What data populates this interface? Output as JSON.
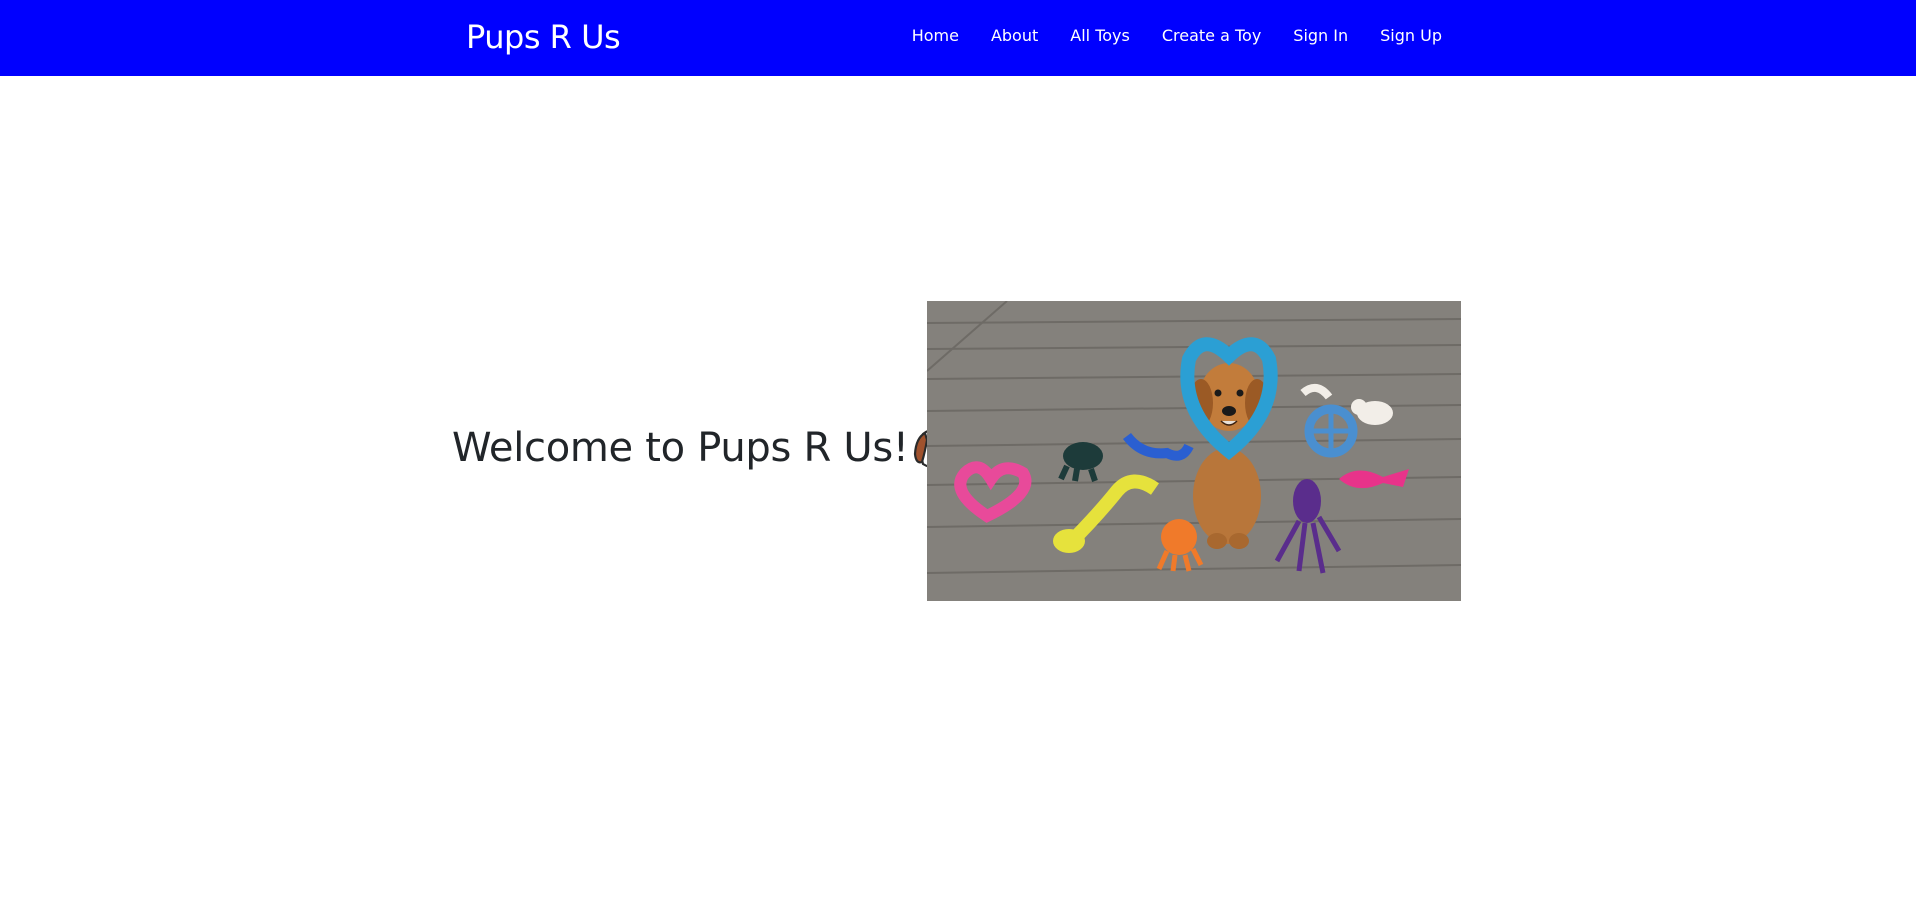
{
  "navbar": {
    "brand": "Pups R Us",
    "links": [
      "Home",
      "About",
      "All Toys",
      "Create a Toy",
      "Sign In",
      "Sign Up"
    ]
  },
  "hero": {
    "heading": "Welcome to Pups R Us!",
    "heading_icon": "dog-face-icon",
    "image": "dog-with-rope-toys-photo"
  },
  "colors": {
    "navbar_bg": "#0000ff",
    "nav_text": "#ffffff",
    "heading_text": "#212529",
    "page_bg": "#ffffff"
  }
}
